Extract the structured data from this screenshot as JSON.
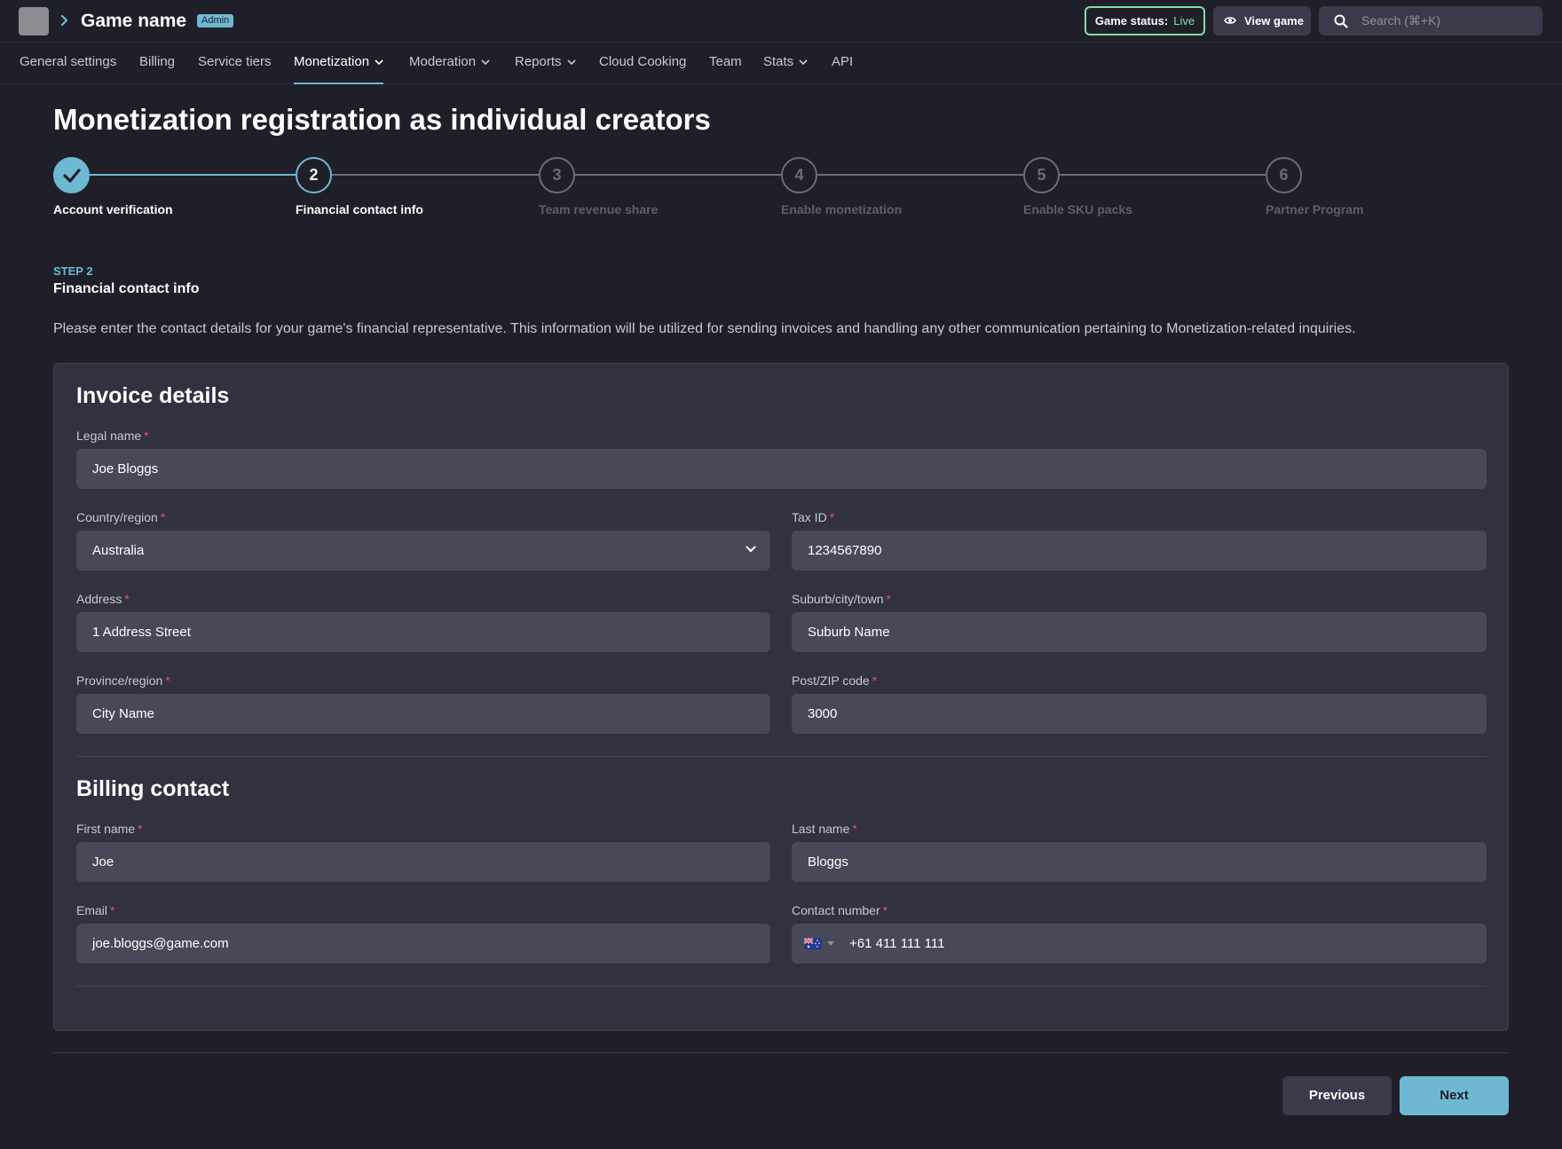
{
  "header": {
    "game_name": "Game name",
    "admin_badge": "Admin",
    "game_status_label": "Game status:",
    "game_status_value": "Live",
    "view_game_label": "View game",
    "search_placeholder": "Search (⌘+K)"
  },
  "nav": {
    "tabs": [
      {
        "label": "General settings"
      },
      {
        "label": "Billing"
      },
      {
        "label": "Service tiers"
      },
      {
        "label": "Monetization"
      },
      {
        "label": "Moderation"
      },
      {
        "label": "Reports"
      },
      {
        "label": "Cloud Cooking"
      },
      {
        "label": "Team"
      },
      {
        "label": "Stats"
      },
      {
        "label": "API"
      }
    ]
  },
  "page": {
    "title": "Monetization registration as individual creators"
  },
  "stepper": {
    "steps": [
      {
        "number": "1",
        "label": "Account verification",
        "state": "done"
      },
      {
        "number": "2",
        "label": "Financial contact info",
        "state": "current"
      },
      {
        "number": "3",
        "label": "Team revenue share",
        "state": "upcoming"
      },
      {
        "number": "4",
        "label": "Enable monetization",
        "state": "upcoming"
      },
      {
        "number": "5",
        "label": "Enable SKU packs",
        "state": "upcoming"
      },
      {
        "number": "6",
        "label": "Partner Program",
        "state": "upcoming"
      }
    ]
  },
  "step_intro": {
    "kicker": "STEP 2",
    "heading": "Financial contact info",
    "description": "Please enter the contact details for your game's financial representative. This information will be utilized for sending invoices and handling any other communication pertaining to Monetization-related inquiries."
  },
  "invoice": {
    "title": "Invoice details",
    "legal_name": {
      "label": "Legal name",
      "value": "Joe Bloggs"
    },
    "country": {
      "label": "Country/region",
      "value": "Australia"
    },
    "tax_id": {
      "label": "Tax ID",
      "value": "1234567890"
    },
    "address": {
      "label": "Address",
      "value": "1 Address Street"
    },
    "suburb": {
      "label": "Suburb/city/town",
      "value": "Suburb Name"
    },
    "province": {
      "label": "Province/region",
      "value": "City Name"
    },
    "postcode": {
      "label": "Post/ZIP code",
      "value": "3000"
    }
  },
  "billing": {
    "title": "Billing contact",
    "first_name": {
      "label": "First name",
      "value": "Joe"
    },
    "last_name": {
      "label": "Last name",
      "value": "Bloggs"
    },
    "email": {
      "label": "Email",
      "value": "joe.bloggs@game.com"
    },
    "contact_number": {
      "label": "Contact number",
      "value": "+61 411 111 111"
    }
  },
  "footer": {
    "previous_label": "Previous",
    "next_label": "Next"
  },
  "colors": {
    "accent": "#6fb8d1",
    "live_status": "#7ee0a3",
    "required": "#e0575b",
    "background": "#1f1f29",
    "card": "#31313f",
    "input": "#484858"
  },
  "icons": [
    "chevron-right-icon",
    "eye-icon",
    "search-icon",
    "chevron-down-icon",
    "checkmark-icon",
    "australia-flag-icon"
  ]
}
